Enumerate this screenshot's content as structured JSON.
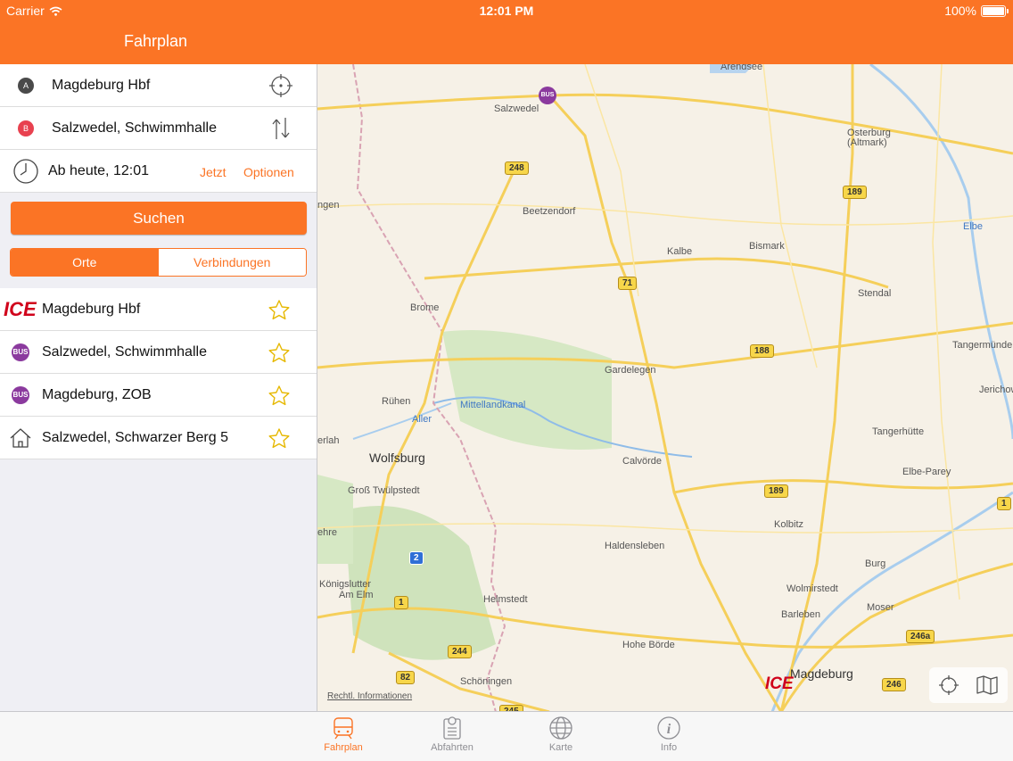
{
  "status_bar": {
    "carrier": "Carrier",
    "time": "12:01 PM",
    "battery": "100%"
  },
  "nav": {
    "title": "Fahrplan"
  },
  "route": {
    "from_badge": "A",
    "from": "Magdeburg Hbf",
    "to_badge": "B",
    "to": "Salzwedel, Schwimmhalle",
    "time": "Ab heute, 12:01",
    "now_label": "Jetzt",
    "options_label": "Optionen"
  },
  "search_label": "Suchen",
  "segments": {
    "places": "Orte",
    "connections": "Verbindungen",
    "selected": "Orte"
  },
  "favorites": [
    {
      "badge": "ICE",
      "name": "Magdeburg Hbf"
    },
    {
      "badge": "BUS",
      "name": "Salzwedel, Schwimmhalle"
    },
    {
      "badge": "BUS",
      "name": "Magdeburg, ZOB"
    },
    {
      "badge": "home-icon",
      "name": "Salzwedel, Schwarzer Berg 5"
    }
  ],
  "map": {
    "cities": [
      "Arendsee",
      "Salzwedel",
      "Osterburg",
      "(Altmark)",
      "Beetzendorf",
      "Kalbe",
      "Bismark",
      "Stendal",
      "Tangermünde",
      "Brome",
      "Gardelegen",
      "Rühen",
      "Mittellandkanal",
      "Aller",
      "Jerichow",
      "Tangerhütte",
      "Wolfsburg",
      "Calvörde",
      "Elbe-Parey",
      "Groß Twülpstedt",
      "Kolbitz",
      "Haldensleben",
      "Burg",
      "Königslutter",
      "Am Elm",
      "Wolmirstedt",
      "Helmstedt",
      "Barleben",
      "Moser",
      "Hohe Börde",
      "Schöningen",
      "Magdeburg",
      "Elbe",
      "ngen",
      "erlah",
      "ehre"
    ],
    "road_shields": [
      "248",
      "189",
      "71",
      "188",
      "189",
      "2",
      "1",
      "244",
      "82",
      "246a",
      "246",
      "1",
      "245"
    ],
    "legal": "Rechtl. Informationen",
    "ice_label": "ICE",
    "bus_label": "BUS"
  },
  "tabs": [
    {
      "label": "Fahrplan",
      "icon": "train-icon"
    },
    {
      "label": "Abfahrten",
      "icon": "departures-icon"
    },
    {
      "label": "Karte",
      "icon": "globe-icon"
    },
    {
      "label": "Info",
      "icon": "info-icon"
    }
  ],
  "colors": {
    "accent": "#fb7425",
    "ice": "#d0021b",
    "bus": "#8b3a9e"
  }
}
